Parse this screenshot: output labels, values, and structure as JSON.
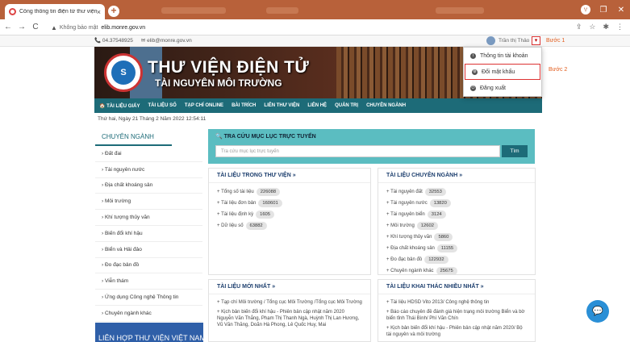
{
  "browser": {
    "tab_title": "Cổng thông tin điện tử thư viện",
    "tab_close": "×",
    "new_tab": "+",
    "back": "←",
    "forward": "→",
    "reload": "C",
    "security": "Không bảo mật",
    "url": "elib.monre.gov.vn",
    "window_min": "–",
    "window_max": "❐",
    "window_close": "✕",
    "profile_icon": "v"
  },
  "header": {
    "phone": "📞 04.37548925",
    "email": "✉ elib@monre.gov.vn",
    "user_name": "Trần thị Thảo",
    "caret": "▾",
    "step1": "Bước 1",
    "step2": "Bước 2"
  },
  "dropdown": {
    "items": [
      {
        "icon": "i",
        "label": "Thông tin tài khoản"
      },
      {
        "icon": "⚙",
        "label": "Đổi mật khẩu"
      },
      {
        "icon": "⏻",
        "label": "Đăng xuất"
      }
    ]
  },
  "banner": {
    "title": "THƯ VIỆN ĐIỆN TỬ",
    "subtitle": "TÀI NGUYÊN MÔI TRƯỜNG",
    "logo_text": "S"
  },
  "menu": [
    "🏠 TÀI LIỆU GIẤY",
    "TÀI LIỆU SỐ",
    "TẠP CHÍ ONLINE",
    "BÀI TRÍCH",
    "LIÊN THƯ VIỆN",
    "LIÊN HỆ",
    "QUẢN TRỊ",
    "CHUYÊN NGÀNH"
  ],
  "date": "Thứ hai, Ngày 21 Tháng 2 Năm 2022 12:54:11",
  "sidebar": {
    "title": "CHUYÊN NGÀNH",
    "items": [
      "› Đất đai",
      "› Tài nguyên nước",
      "› Địa chất khoáng sản",
      "› Môi trường",
      "› Khí tượng thủy văn",
      "› Biến đổi khí hậu",
      "› Biển và Hải đảo",
      "› Đo đạc bản đồ",
      "› Viễn thám",
      "› Ứng dụng Công nghệ Thông tin",
      "› Chuyên ngành khác"
    ],
    "bottom_banner": "LIÊN HỢP THƯ VIỆN VIỆT NAM"
  },
  "search": {
    "title": "🔍 TRA CỨU MỤC LỤC TRỰC TUYẾN",
    "placeholder": "Tra cứu mục lục trực tuyến",
    "button": "Tìm"
  },
  "library_docs": {
    "title": "TÀI LIỆU TRONG THƯ VIỆN »",
    "items": [
      {
        "label": "+ Tổng số tài liệu",
        "value": "226088"
      },
      {
        "label": "+ Tài liệu đơn bản",
        "value": "160601"
      },
      {
        "label": "+ Tài liệu định kỳ",
        "value": "1605"
      },
      {
        "label": "+ Dữ liệu số",
        "value": "63882"
      }
    ]
  },
  "specialized_docs": {
    "title": "TÀI LIỆU CHUYÊN NGÀNH »",
    "items": [
      {
        "label": "+ Tài nguyên đất",
        "value": "32553"
      },
      {
        "label": "+ Tài nguyên nước",
        "value": "13820"
      },
      {
        "label": "+ Tài nguyên biển",
        "value": "3124"
      },
      {
        "label": "+ Môi trường",
        "value": "12602"
      },
      {
        "label": "+ Khí tượng thủy văn",
        "value": "5860"
      },
      {
        "label": "+ Địa chất khoáng sản",
        "value": "11155"
      },
      {
        "label": "+ Đo đạc bản đồ",
        "value": "122932"
      },
      {
        "label": "+ Chuyên ngành khác",
        "value": "25675"
      }
    ]
  },
  "new_docs": {
    "title": "TÀI LIỆU MỚI NHẤT »",
    "items": [
      "+ Tạp chí Môi trường / Tổng cục Môi Trường /Tổng cục Môi Trường",
      "+ Kịch bản biến đổi khí hậu - Phiên bản cập nhật năm 2020 Nguyễn Văn Thắng, Phạm Thị Thanh Ngà, Huỳnh Thị Lan Hương, Vũ Văn Thăng, Doãn Hà Phong, Lê Quốc Huy, Mai"
    ]
  },
  "popular_docs": {
    "title": "TÀI LIỆU KHAI THÁC NHIỀU NHẤT »",
    "items": [
      "+ Tài liệu HDSD Vito 2013/ Công nghệ thông tin",
      "+ Báo cáo chuyên đề đánh giá hiện trạng môi trường Biển và bờ biển tỉnh Thái Bình/ Phí Văn Chín",
      "+ Kịch bản biến đổi khí hậu - Phiên bản cập nhật năm 2020/ Bộ tài nguyên và môi trường"
    ]
  },
  "chat_icon": "💬"
}
